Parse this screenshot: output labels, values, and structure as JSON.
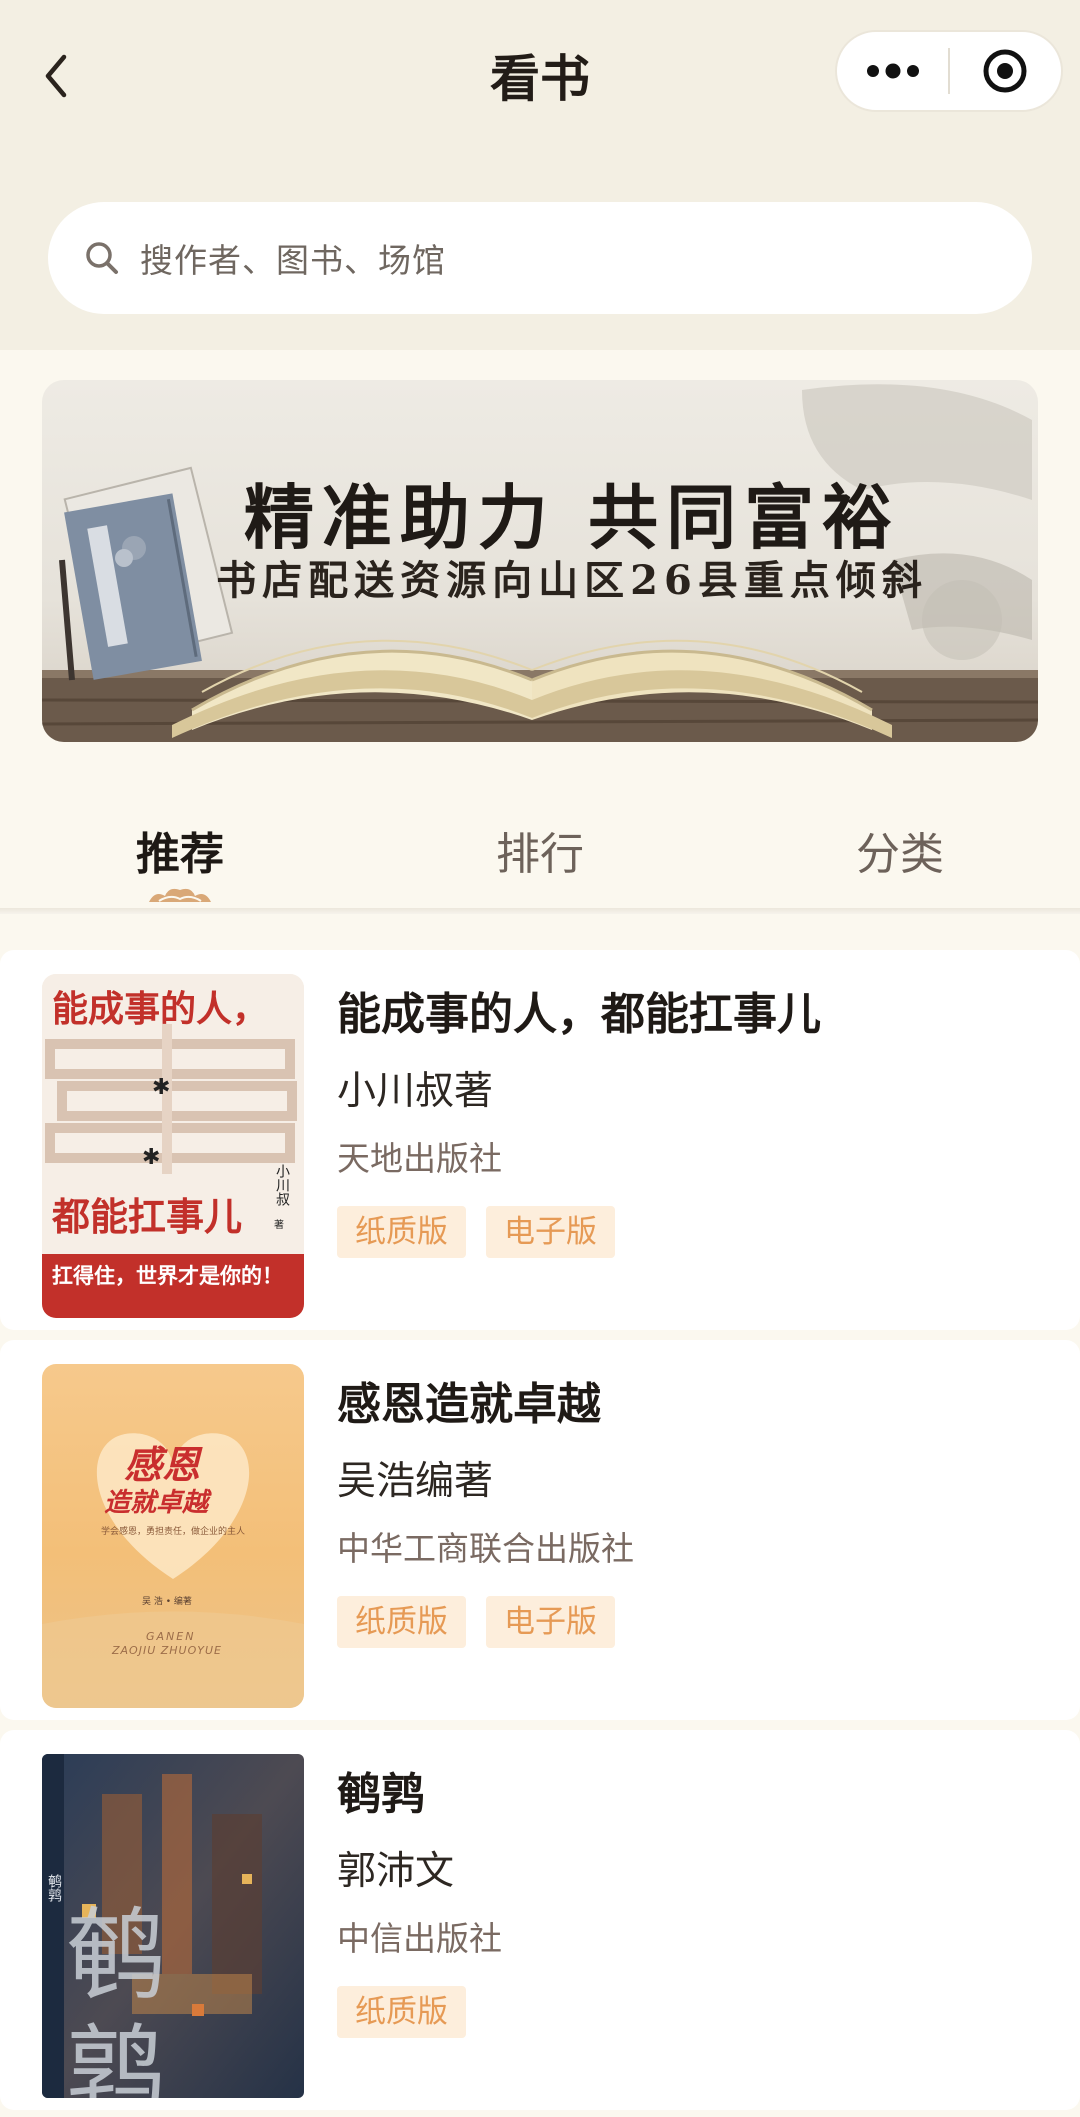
{
  "header": {
    "title": "看书",
    "search_placeholder": "搜作者、图书、场馆"
  },
  "banner": {
    "line1": "精准助力 共同富裕",
    "line2": "书店配送资源向山区26县重点倾斜"
  },
  "tabs": [
    {
      "label": "推荐",
      "active": true
    },
    {
      "label": "排行",
      "active": false
    },
    {
      "label": "分类",
      "active": false
    }
  ],
  "books": [
    {
      "title": "能成事的人，都能扛事儿",
      "author": "小川叔著",
      "publisher": "天地出版社",
      "tags": [
        "纸质版",
        "电子版"
      ],
      "cover": {
        "line_top": "能成事的人，",
        "line_mid": "都能扛事儿",
        "author_vertical": "小川叔",
        "author_suffix": "著",
        "slogan": "扛得住，世界才是你的！"
      }
    },
    {
      "title": "感恩造就卓越",
      "author": "吴浩编著",
      "publisher": "中华工商联合出版社",
      "tags": [
        "纸质版",
        "电子版"
      ],
      "cover": {
        "line1": "感恩",
        "line2": "造就卓越",
        "sub": "学会感恩，勇担责任，做企业的主人",
        "editor": "吴 浩 • 编著",
        "en1": "GANEN",
        "en2": "ZAOJIU ZHUOYUE"
      }
    },
    {
      "title": "鹌鹑",
      "author": "郭沛文",
      "publisher": "中信出版社",
      "tags": [
        "纸质版"
      ],
      "cover": {
        "big1": "鹌",
        "big2": "鹑",
        "spine": "鹌鹑"
      }
    }
  ],
  "colors": {
    "header_bg": "#f3efe3",
    "page_bg": "#fbf8ef",
    "tag_bg": "#fdeedc",
    "tag_text": "#e69a55"
  }
}
